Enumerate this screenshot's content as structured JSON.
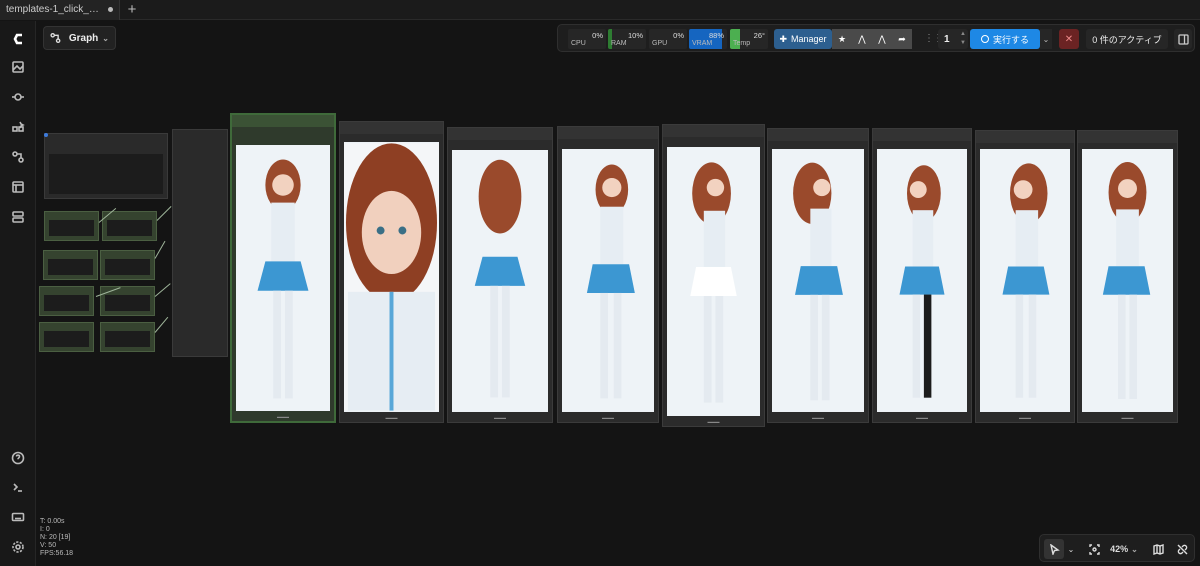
{
  "tabs": [
    {
      "label": "templates-1_click_m..."
    }
  ],
  "toolbar": {
    "graph_label": "Graph",
    "meters": [
      {
        "label": "CPU",
        "value": "0%",
        "fill": 0,
        "color": "#2e7d32"
      },
      {
        "label": "RAM",
        "value": "10%",
        "fill": 10,
        "color": "#2e7d32"
      },
      {
        "label": "GPU",
        "value": "0%",
        "fill": 0,
        "color": "#2e7d32"
      },
      {
        "label": "VRAM",
        "value": "88%",
        "fill": 88,
        "color": "#1565c0"
      },
      {
        "label": "Temp",
        "value": "26°",
        "fill": 26,
        "color": "#4caf50"
      }
    ],
    "manager_label": "Manager",
    "queue_count": "1",
    "run_label": "実行する",
    "active_label": "0 件のアクティブ"
  },
  "stats": {
    "t": "T: 0.00s",
    "i": "I: 0",
    "n": "N: 20 [19]",
    "v": "V: 50",
    "fps": "FPS:56.18"
  },
  "zoom": "42%",
  "colors": {
    "accent": "#1e88e5",
    "vram": "#1565c0",
    "ram": "#2e7d32",
    "node_green": "#35432f",
    "cancel": "#6b2323"
  },
  "icons": {
    "sidebar": [
      "logo-icon",
      "images-icon",
      "model-icon",
      "nodes-icon",
      "workflow-icon",
      "templates-icon",
      "layout-icon",
      "help-icon",
      "terminal-icon",
      "keyboard-icon",
      "settings-icon"
    ]
  }
}
